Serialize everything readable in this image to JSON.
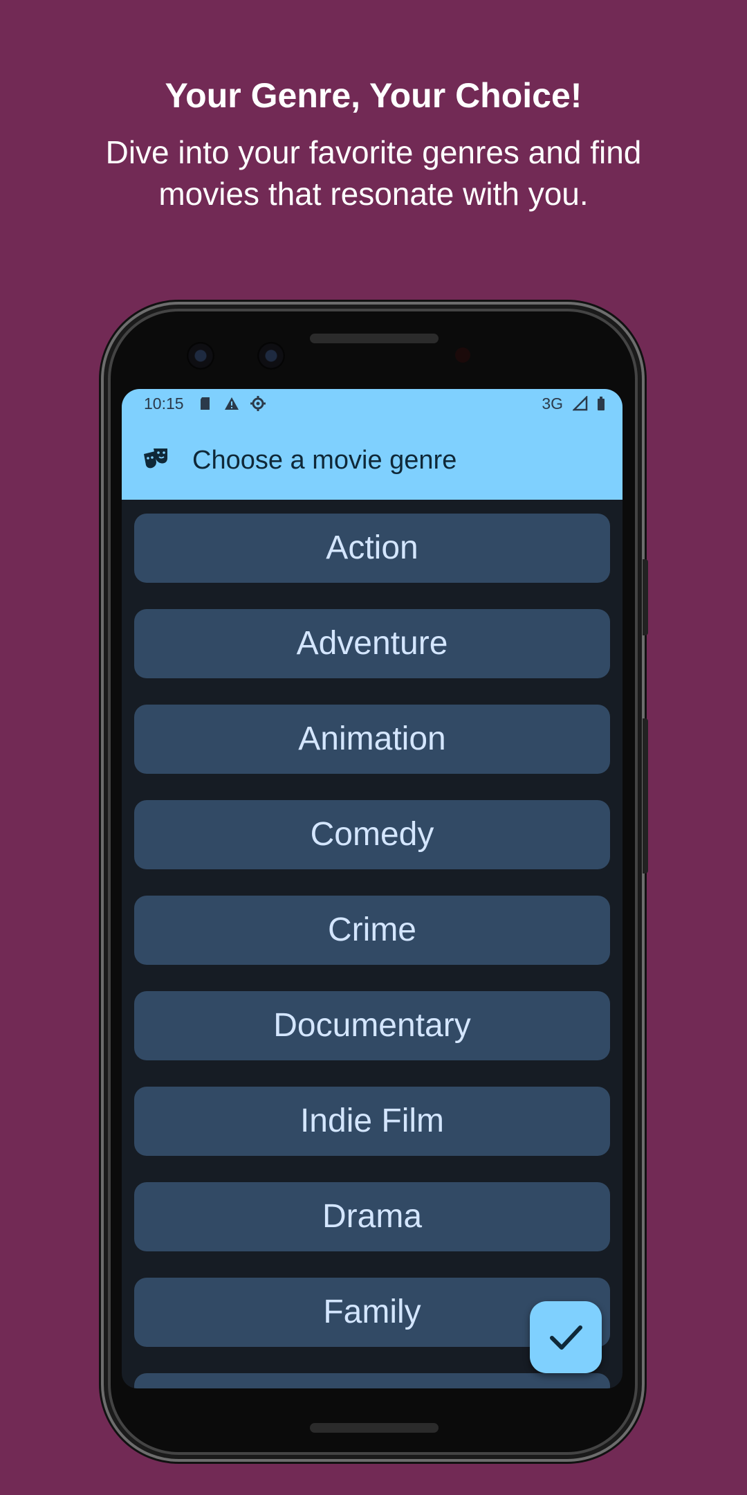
{
  "promo": {
    "headline": "Your Genre, Your Choice!",
    "subline": "Dive into your favorite genres and find movies that resonate with you."
  },
  "statusbar": {
    "time": "10:15",
    "network": "3G",
    "icons": [
      "sd-card-icon",
      "warning-icon",
      "settings-gear-icon",
      "signal-icon",
      "battery-icon"
    ]
  },
  "appbar": {
    "icon": "theater-masks-icon",
    "title": "Choose a movie genre"
  },
  "genres": [
    {
      "label": "Action"
    },
    {
      "label": "Adventure"
    },
    {
      "label": "Animation"
    },
    {
      "label": "Comedy"
    },
    {
      "label": "Crime"
    },
    {
      "label": "Documentary"
    },
    {
      "label": "Indie Film"
    },
    {
      "label": "Drama"
    },
    {
      "label": "Family"
    },
    {
      "label": ""
    }
  ],
  "fab": {
    "icon": "checkmark-icon"
  },
  "colors": {
    "background": "#722a55",
    "accent": "#7fd0fe",
    "button": "#324a65",
    "screen": "#161c24",
    "button_text": "#d4e6ff"
  }
}
